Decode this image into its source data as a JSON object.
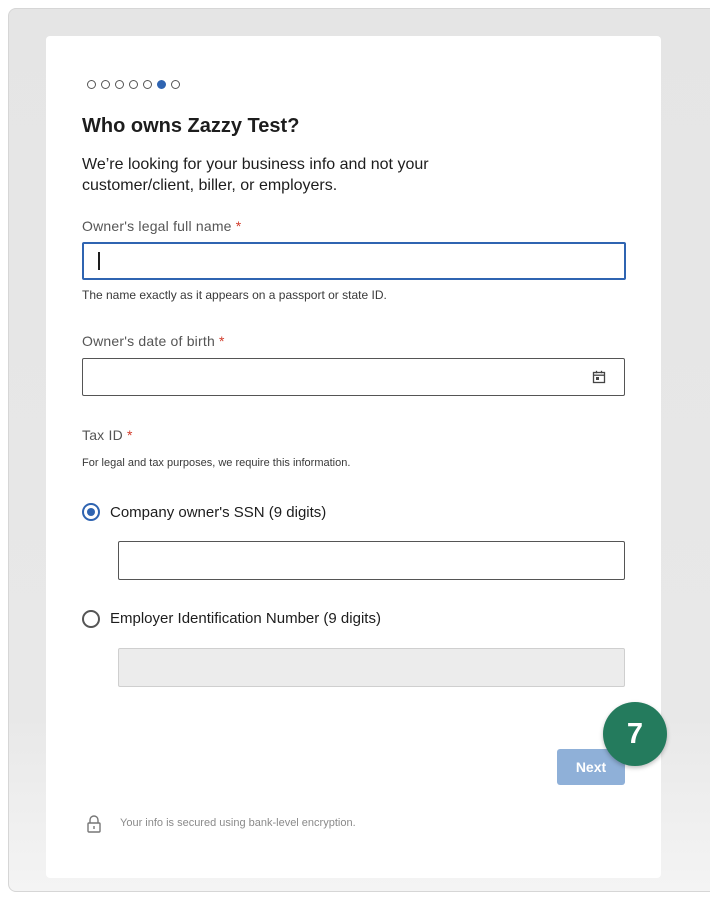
{
  "progress": {
    "total_steps": 7,
    "current_step": 6
  },
  "form": {
    "title": "Who owns Zazzy Test?",
    "subtitle": "We’re looking for your business info and not your customer/client, biller, or employers.",
    "owner_name": {
      "label": "Owner's legal full name",
      "required_mark": "*",
      "value": "",
      "helper": "The name exactly as it appears on a passport or state ID."
    },
    "owner_dob": {
      "label": "Owner's date of birth",
      "required_mark": "*",
      "value": "",
      "icon": "calendar-icon"
    },
    "tax_id": {
      "label": "Tax ID",
      "required_mark": "*",
      "helper": "For legal and tax purposes, we require this information.",
      "options": [
        {
          "label": "Company owner's SSN (9 digits)",
          "selected": true,
          "value": ""
        },
        {
          "label": "Employer Identification Number (9 digits)",
          "selected": false,
          "value": ""
        }
      ]
    },
    "next_label": "Next",
    "security_note": "Your info is secured using bank-level encryption."
  },
  "overlay": {
    "step_badge": "7"
  },
  "colors": {
    "accent": "#2f64b1",
    "required": "#d13b2a",
    "badge": "#247b5d",
    "next_disabled": "#8fb0d8"
  }
}
